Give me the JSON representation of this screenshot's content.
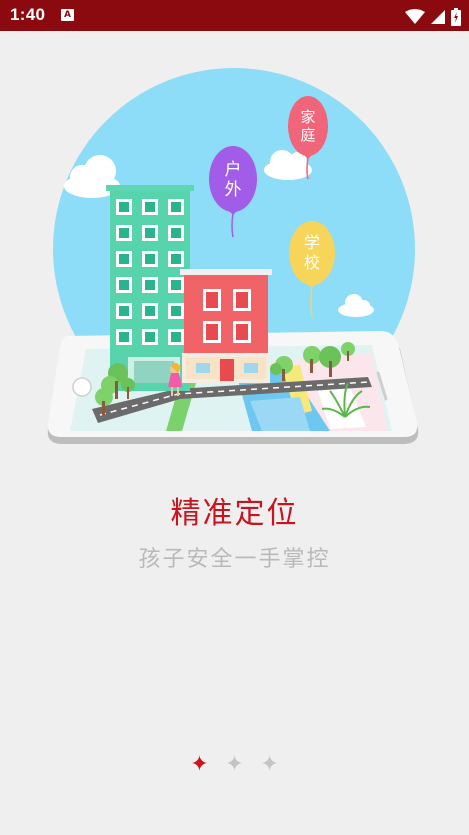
{
  "status_bar": {
    "time": "1:40",
    "notification_icon": "A",
    "icons": [
      "wifi-icon",
      "signal-icon",
      "battery-icon"
    ],
    "background": "#8b0a10"
  },
  "illustration": {
    "balloons": [
      {
        "label_top": "家",
        "label_bottom": "庭",
        "color": "#f0657a"
      },
      {
        "label_top": "户",
        "label_bottom": "外",
        "color": "#a25de8"
      },
      {
        "label_top": "学",
        "label_bottom": "校",
        "color": "#f7d55b"
      }
    ]
  },
  "onboarding": {
    "title": "精准定位",
    "subtitle": "孩子安全一手掌控",
    "title_color": "#c8141e",
    "subtitle_color": "#b9b9b9"
  },
  "pager": {
    "total": 3,
    "active_index": 0,
    "active_color": "#d0101a",
    "inactive_color": "#c4c4c4"
  }
}
